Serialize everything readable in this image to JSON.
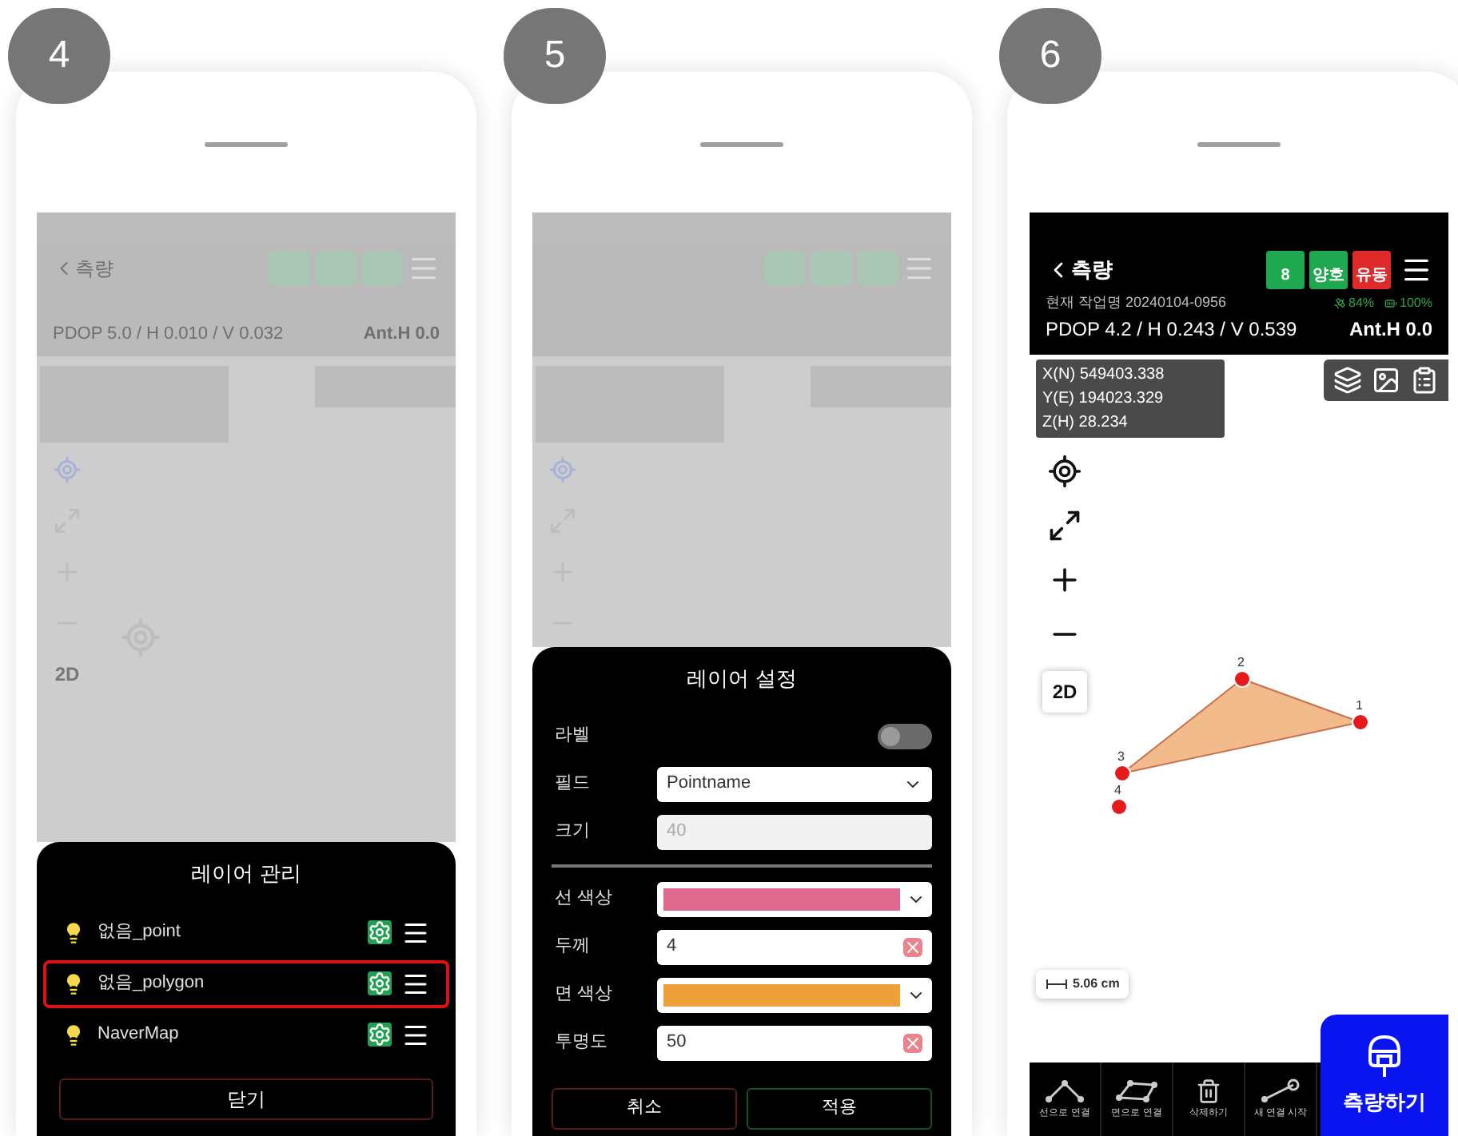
{
  "panels": [
    {
      "step": "4",
      "kind": "layers",
      "dimmed_header": {
        "back": "측량",
        "pdop": "PDOP 5.0 / H 0.010 / V 0.032",
        "ant": "Ant.H 0.0"
      },
      "view_mode": "2D",
      "sheet": {
        "title": "레이어 관리",
        "layers": [
          {
            "name": "없음_point",
            "selected": false
          },
          {
            "name": "없음_polygon",
            "selected": true
          },
          {
            "name": "NaverMap",
            "selected": false
          }
        ],
        "close": "닫기"
      }
    },
    {
      "step": "5",
      "kind": "settings",
      "sheet": {
        "title": "레이어 설정",
        "groups": [
          [
            {
              "kind": "toggle",
              "label": "라벨",
              "on": false
            },
            {
              "kind": "select",
              "label": "필드",
              "value": "Pointname"
            },
            {
              "kind": "input",
              "label": "크기",
              "value": "40",
              "disabled": true,
              "clearable": false
            }
          ],
          [
            {
              "kind": "color",
              "label": "선 색상",
              "color": "#e0698f"
            },
            {
              "kind": "input",
              "label": "두께",
              "value": "4",
              "disabled": false,
              "clearable": true
            },
            {
              "kind": "color",
              "label": "면 색상",
              "color": "#eea13a"
            },
            {
              "kind": "input",
              "label": "투명도",
              "value": "50",
              "disabled": false,
              "clearable": true
            }
          ]
        ],
        "cancel": "취소",
        "apply": "적용"
      }
    },
    {
      "step": "6",
      "kind": "map",
      "header": {
        "back": "측량",
        "badges": [
          {
            "value": "8",
            "color": "#1fa84f"
          },
          {
            "value": "양호",
            "color": "#1fa84f"
          },
          {
            "value": "유동",
            "color": "#e02a2a"
          }
        ],
        "work": "현재 작업명 20240104-0956",
        "satellite": "84%",
        "battery": "100%",
        "pdop": "PDOP 4.2 / H 0.243 / V 0.539",
        "ant": "Ant.H 0.0"
      },
      "coords": [
        "X(N) 549403.338",
        "Y(E) 194023.329",
        "Z(H) 28.234"
      ],
      "view_mode": "2D",
      "points": [
        {
          "label": "1"
        },
        {
          "label": "2"
        },
        {
          "label": "3"
        },
        {
          "label": "4"
        }
      ],
      "scale": "5.06 cm",
      "toolbar": [
        "선으로 연결",
        "면으로 연결",
        "삭제하기",
        "새 연결 시작"
      ],
      "measure": "측량하기"
    }
  ]
}
